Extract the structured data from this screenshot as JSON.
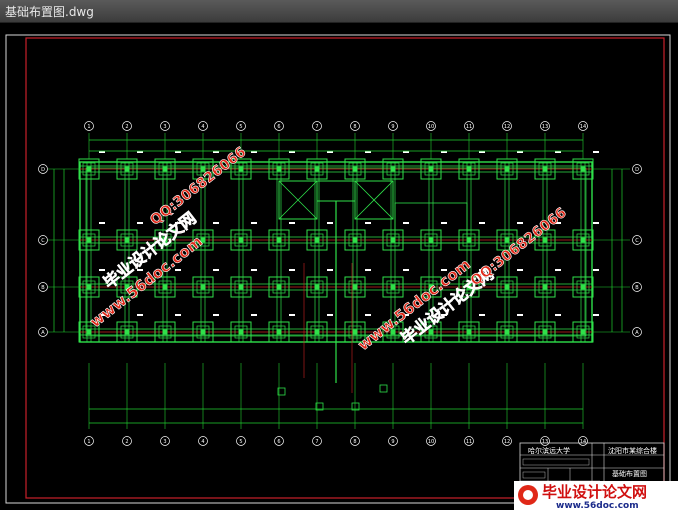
{
  "window": {
    "title": "基础布置图.dwg"
  },
  "drawing": {
    "axis_letters": [
      "D",
      "C",
      "B",
      "A"
    ],
    "axis_numbers": [
      "1",
      "2",
      "3",
      "4",
      "5",
      "6",
      "7",
      "8",
      "9",
      "10",
      "11",
      "12",
      "13",
      "14"
    ],
    "title_block": {
      "school": "哈尔滨远大学",
      "project": "沈阳市某综合楼",
      "drawing_name": "基础布置图"
    }
  },
  "watermarks": {
    "site": "www.56doc.com",
    "qq": "QQ:306826066",
    "brand": "毕业设计论文网",
    "banner_brand": "毕业设计论文网",
    "banner_site": "www.56doc.com"
  },
  "colors": {
    "background": "#000000",
    "frame_red": "#c8202a",
    "frame_white": "#d8d8d8",
    "structure_green": "#2fe04a",
    "axis_line_red": "#d02020",
    "dimension_green": "#20d030",
    "watermark_red": "#e02818"
  }
}
